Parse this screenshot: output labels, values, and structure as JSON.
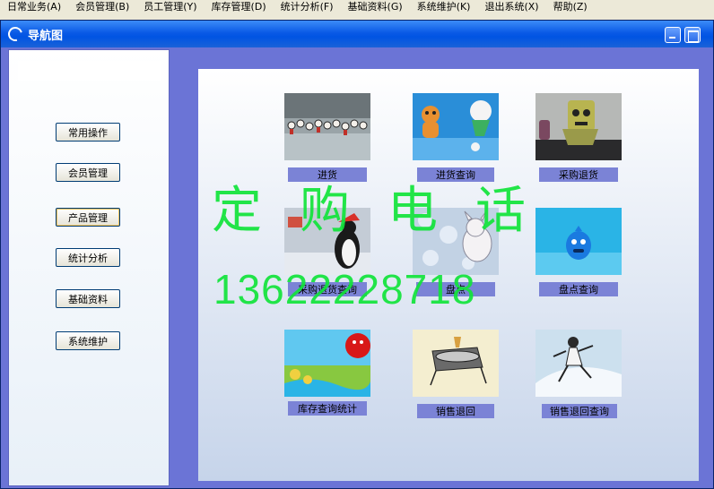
{
  "menubar": {
    "items": [
      "日常业务(A)",
      "会员管理(B)",
      "员工管理(Y)",
      "库存管理(D)",
      "统计分析(F)",
      "基础资料(G)",
      "系统维护(K)",
      "退出系统(X)",
      "帮助(Z)"
    ]
  },
  "window": {
    "title": "导航图"
  },
  "sidebar": {
    "buttons": [
      "常用操作",
      "会员管理",
      "产品管理",
      "统计分析",
      "基础资料",
      "系统维护"
    ]
  },
  "tiles": [
    {
      "label": "进货"
    },
    {
      "label": "进货查询"
    },
    {
      "label": "采购退货"
    },
    {
      "label": "采购退货查询"
    },
    {
      "label": "盘点"
    },
    {
      "label": "盘点查询"
    },
    {
      "label": "库存查询统计"
    },
    {
      "label": "销售退回"
    },
    {
      "label": "销售退回查询"
    }
  ],
  "watermark": {
    "line1": "定购电话",
    "line2": "13622228718"
  },
  "colors": {
    "accent": "#0054e3",
    "body_bg": "#6b74d6",
    "caption_bg": "#7b83d6",
    "watermark": "#11e43a"
  }
}
